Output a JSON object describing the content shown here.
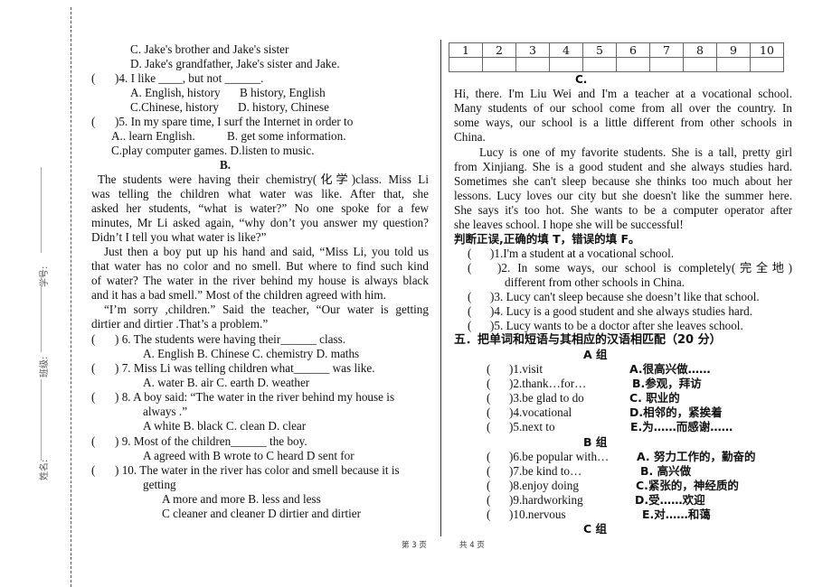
{
  "binding_margin": {
    "student_id_label": "学号:",
    "class_label": "班级:",
    "name_label": "姓名:"
  },
  "left_column": {
    "q3_options": {
      "c": "C. Jake's brother and Jake's sister",
      "d": "D. Jake's grandfather, Jake's sister and Jake."
    },
    "q4": {
      "paren": "(",
      "stem": ")4. I like ____, but not ______.",
      "opt_a": "A. English, history",
      "opt_b": "B history, English",
      "opt_c": "C.Chinese, history",
      "opt_d": "D. history, Chinese"
    },
    "q5": {
      "paren": "(",
      "stem": ")5. In my spare time, I surf the Internet in order to",
      "opt_a": "A.. learn English.",
      "opt_b": "B. get some information.",
      "opt_cd": "C.play computer games. D.listen to music."
    },
    "section_b": {
      "heading": "B.",
      "passage_lines": [
        "The students were having their chemistry(化学)class. Miss Li",
        "was telling the children what water was like. After that, she",
        "asked her students, “what is water?” No one spoke for a few",
        "minutes, Mr Li asked again, “why don’t you answer my question?",
        "Didn’t I tell you what water is like?”",
        "Just then a boy put up his hand and said, “Miss Li, you told us",
        "that water has no color and no smell. But where to find such kind",
        "of water? The water in the river behind my house is always black",
        "and it has a bad smell.”    Most of the children agreed with him.",
        "“I’m sorry ,children.” Said the teacher, “Our water is getting",
        "dirtier and dirtier .That’s a problem.”"
      ],
      "questions": [
        {
          "paren": "(",
          "stem": ") 6. The students were having their______ class.",
          "options": "A. English B. Chinese    C. chemistry D. maths"
        },
        {
          "paren": "(",
          "stem": ") 7. Miss Li was telling children what______ was like.",
          "options": "A. water      B. air      C. earth      D. weather"
        },
        {
          "paren": "(",
          "stem": ") 8. A boy said: “The water in the river behind my house is",
          "stem2": "always .”",
          "options": "A white      B. black      C. clean     D. clear"
        },
        {
          "paren": "(",
          "stem": ") 9. Most of    the children______ the boy.",
          "options": "A    agreed with    B wrote to    C heard    D    sent for"
        },
        {
          "paren": "(",
          "stem": ") 10. The water in the river has color and smell because it is",
          "stem2": "getting",
          "options": "A    more and more          B.    less and less",
          "options2": "C    cleaner and cleaner      D dirtier and dirtier"
        }
      ]
    }
  },
  "right_column": {
    "answer_table": {
      "headers": [
        "1",
        "2",
        "3",
        "4",
        "5",
        "6",
        "7",
        "8",
        "9",
        "10"
      ],
      "answers": [
        "",
        "",
        "",
        "",
        "",
        "",
        "",
        "",
        "",
        ""
      ]
    },
    "section_c": {
      "heading": "C.",
      "passage_lines": [
        "Hi, there. I'm Liu Wei and I'm a teacher at a vocational school.",
        "Many students of our school come from all over the country. In",
        "some ways, our school is a little different from other schools in",
        "China.",
        "Lucy is one of my favorite students. She is a tall, pretty girl",
        "from Xinjiang. She is a good student and she always studies hard.",
        "Sometimes she can't sleep because she thinks too much about her",
        "lessons. Lucy loves our city but she doesn't like the summer here.",
        "She says it's too hot. She wants to be a computer operator after",
        "she leaves school. I hope she will be successful!"
      ],
      "tf_instruction": "判断正误,正确的填 T，错误的填 F。",
      "tf_items": [
        {
          "paren": "(",
          "text": ")1.I'm a student at a vocational school."
        },
        {
          "paren": "(",
          "text": ")2. In some ways, our school is completely(完全地)",
          "text2": "different from other schools in China."
        },
        {
          "paren": "(",
          "text": ")3. Lucy can't sleep because she doesn’t like that school."
        },
        {
          "paren": "(",
          "text": ")4. Lucy is a good student and she always studies hard."
        },
        {
          "paren": "(",
          "text": ")5. Lucy wants to be a doctor after she leaves school."
        }
      ]
    },
    "section_5": {
      "title": "五．把单词和短语与其相应的汉语相匹配（20 分）",
      "group_a": {
        "heading": "A 组",
        "items": [
          {
            "paren": "(",
            "en": ")1.visit",
            "zh": "A.很高兴做……"
          },
          {
            "paren": "(",
            "en": ")2.thank…for…",
            "zh": "B.参观，拜访"
          },
          {
            "paren": "(",
            "en": ")3.be glad to do",
            "zh": "C. 职业的"
          },
          {
            "paren": "(",
            "en": ")4.vocational",
            "zh": "D.相邻的，紧挨着"
          },
          {
            "paren": "(",
            "en": ")5.next to",
            "zh": "E.为……而感谢……"
          }
        ]
      },
      "group_b": {
        "heading": "B 组",
        "items": [
          {
            "paren": "(",
            "en": ")6.be popular with…",
            "zh": "A. 努力工作的，勤奋的"
          },
          {
            "paren": "(",
            "en": ")7.be kind to…",
            "zh": "B. 高兴做"
          },
          {
            "paren": "(",
            "en": ")8.enjoy doing",
            "zh": "C.紧张的，神经质的"
          },
          {
            "paren": "(",
            "en": ")9.hardworking",
            "zh": "D.受……欢迎"
          },
          {
            "paren": "(",
            "en": ")10.nervous",
            "zh": "E.对……和蔼"
          }
        ]
      },
      "group_c": {
        "heading": "C 组"
      }
    }
  },
  "footer": {
    "page_current": "第 3 页",
    "page_total": "共 4 页"
  }
}
